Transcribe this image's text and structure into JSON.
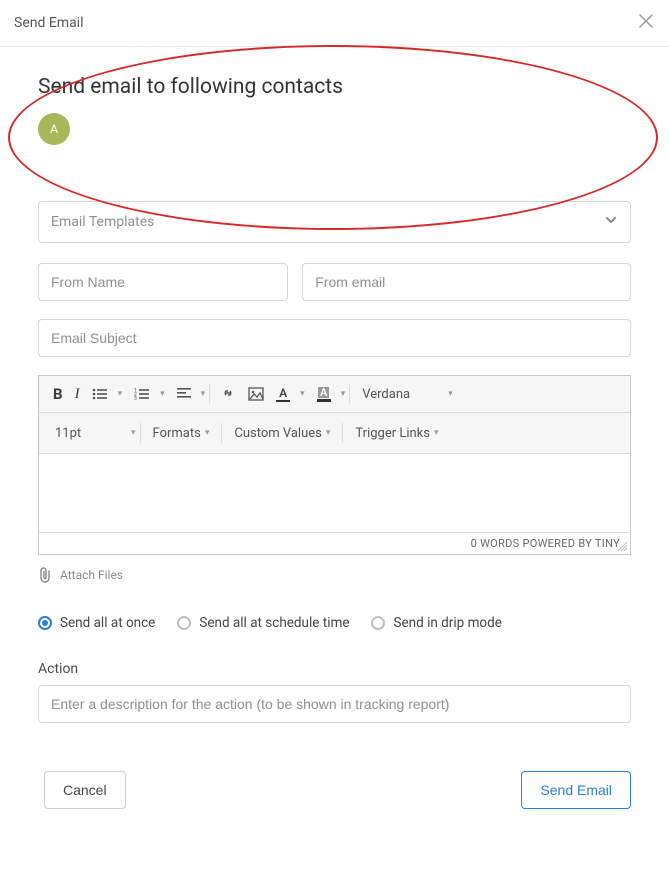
{
  "header": {
    "title": "Send Email"
  },
  "contacts": {
    "heading": "Send email to following contacts",
    "items": [
      {
        "initial": "A"
      }
    ]
  },
  "templates": {
    "placeholder": "Email Templates"
  },
  "from": {
    "name_placeholder": "From Name",
    "email_placeholder": "From email"
  },
  "subject": {
    "placeholder": "Email Subject"
  },
  "editor": {
    "font_family": "Verdana",
    "font_size": "11pt",
    "menus": {
      "formats": "Formats",
      "custom_values": "Custom Values",
      "trigger_links": "Trigger Links"
    },
    "footer": "0 WORDS POWERED BY TINY"
  },
  "attach": {
    "label": "Attach Files"
  },
  "send_mode": {
    "options": [
      {
        "label": "Send all at once",
        "selected": true
      },
      {
        "label": "Send all at schedule time",
        "selected": false
      },
      {
        "label": "Send in drip mode",
        "selected": false
      }
    ]
  },
  "action": {
    "label": "Action",
    "placeholder": "Enter a description for the action (to be shown in tracking report)"
  },
  "buttons": {
    "cancel": "Cancel",
    "send": "Send Email"
  }
}
